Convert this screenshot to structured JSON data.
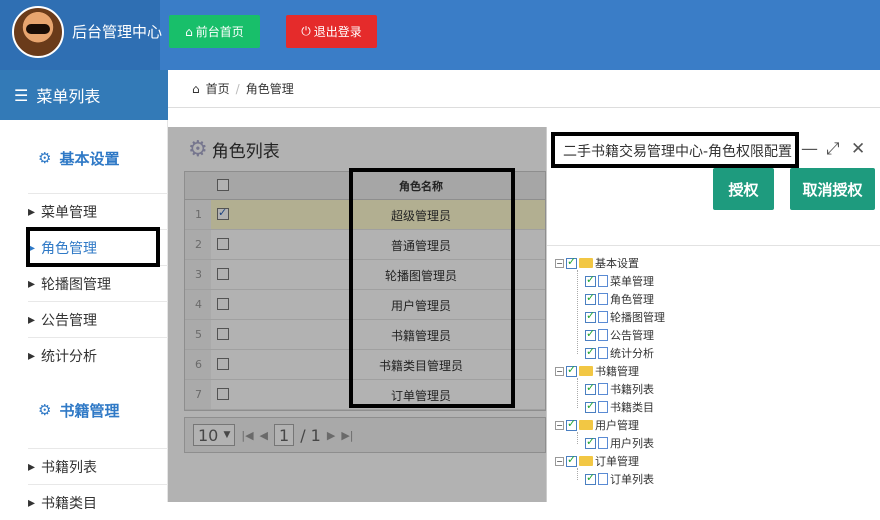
{
  "header": {
    "brand": "后台管理中心",
    "home_btn": "前台首页",
    "logout_btn": "退出登录"
  },
  "sidebar": {
    "title": "菜单列表",
    "group1": "基本设置",
    "items1": [
      "菜单管理",
      "角色管理",
      "轮播图管理",
      "公告管理",
      "统计分析"
    ],
    "group2": "书籍管理",
    "items2": [
      "书籍列表",
      "书籍类目"
    ]
  },
  "breadcrumb": {
    "home": "首页",
    "current": "角色管理"
  },
  "main": {
    "title": "角色列表",
    "column": "角色名称",
    "rows": [
      {
        "n": "1",
        "name": "超级管理员",
        "checked": true
      },
      {
        "n": "2",
        "name": "普通管理员",
        "checked": false
      },
      {
        "n": "3",
        "name": "轮播图管理员",
        "checked": false
      },
      {
        "n": "4",
        "name": "用户管理员",
        "checked": false
      },
      {
        "n": "5",
        "name": "书籍管理员",
        "checked": false
      },
      {
        "n": "6",
        "name": "书籍类目管理员",
        "checked": false
      },
      {
        "n": "7",
        "name": "订单管理员",
        "checked": false
      }
    ],
    "pager": {
      "page_size": "10",
      "page": "1",
      "total": "/ 1"
    }
  },
  "dialog": {
    "title": "二手书籍交易管理中心-角色权限配置",
    "auth_btn": "授权",
    "cancel_btn": "取消授权",
    "tree": [
      {
        "label": "基本设置",
        "children": [
          "菜单管理",
          "角色管理",
          "轮播图管理",
          "公告管理",
          "统计分析"
        ]
      },
      {
        "label": "书籍管理",
        "children": [
          "书籍列表",
          "书籍类目"
        ]
      },
      {
        "label": "用户管理",
        "children": [
          "用户列表"
        ]
      },
      {
        "label": "订单管理",
        "children": [
          "订单列表"
        ]
      }
    ]
  },
  "colors": {
    "header": "#3a7dc7",
    "green": "#18bf6a",
    "red": "#e52b2b",
    "teal": "#1e9b7e",
    "link": "#2f79c6"
  }
}
